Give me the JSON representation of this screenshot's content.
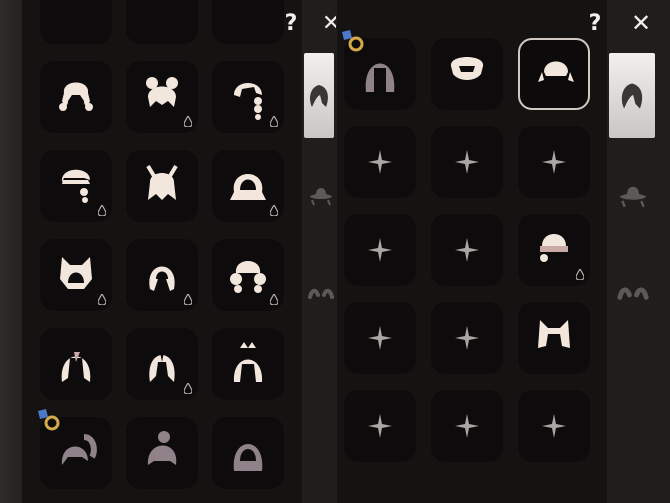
{
  "header": {
    "help_label": "?",
    "close_label": "✕"
  },
  "left_panel": {
    "rows": [
      [
        "hair-partial",
        "hair-partial",
        "hair-partial"
      ],
      [
        "pigtail-hair",
        "twin-bun-hair",
        "side-braid-hair"
      ],
      [
        "bob-braids-hair",
        "horned-hair",
        "hood-hair"
      ],
      [
        "cat-ear-hood",
        "long-hood-hair",
        "curly-pigtail-hair"
      ],
      [
        "long-parted-hair",
        "veil-hair",
        "crown-hair"
      ],
      [
        "ponytail-hair",
        "bun-hair",
        "hooded-cloak-hair"
      ]
    ],
    "drop_slots": [
      "1-1",
      "1-2",
      "2-0",
      "2-2",
      "3-0",
      "3-1",
      "3-2",
      "4-1"
    ],
    "badge_slot": "5-0"
  },
  "right_panel": {
    "rows": [
      [
        "long-hair",
        "lion-mask",
        "bob-pigtail-hair"
      ],
      [
        "empty",
        "empty",
        "empty"
      ],
      [
        "empty",
        "empty",
        "beanie-braid-hair"
      ],
      [
        "empty",
        "empty",
        "cat-ear-hair"
      ],
      [
        "empty",
        "empty",
        "empty"
      ]
    ],
    "selected_slot": "0-2",
    "drop_slots": [
      "2-2"
    ],
    "badge_slot": "0-0"
  },
  "sidebar_tabs": [
    "hair-tab",
    "hat-tab",
    "accessory-tab"
  ],
  "colors": {
    "item": "#f3e6dc",
    "item_shadow": "#caa9a6",
    "dark_item": "#8f8288",
    "slot_bg": "#0d0b0b",
    "panel_bg": "#151312",
    "star": "#aaa6a3",
    "badge_ring": "#d4a94a",
    "badge_blue": "#4b79c9"
  }
}
